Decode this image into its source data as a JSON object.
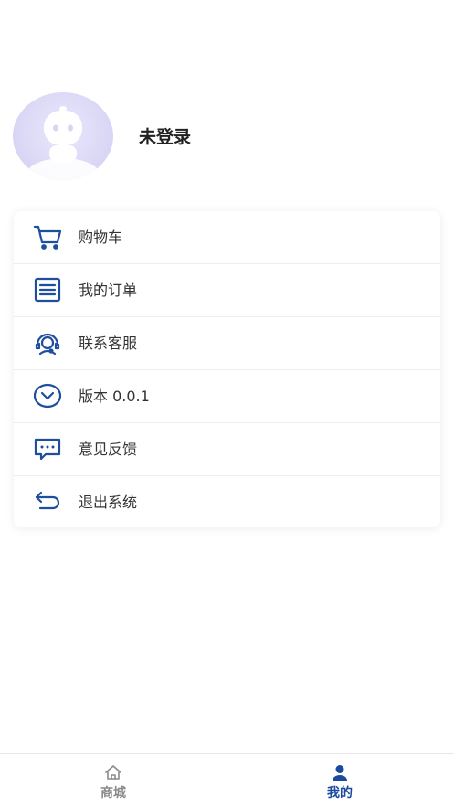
{
  "profile": {
    "username": "未登录"
  },
  "menu": {
    "items": [
      {
        "label": "购物车",
        "icon": "cart-icon"
      },
      {
        "label": "我的订单",
        "icon": "order-list-icon"
      },
      {
        "label": "联系客服",
        "icon": "customer-service-icon"
      },
      {
        "label": "版本 0.0.1",
        "icon": "chevron-down-circle-icon"
      },
      {
        "label": "意见反馈",
        "icon": "feedback-chat-icon"
      },
      {
        "label": "退出系统",
        "icon": "back-arrow-icon"
      }
    ]
  },
  "tabbar": {
    "tabs": [
      {
        "label": "商城",
        "icon": "home-icon",
        "active": false
      },
      {
        "label": "我的",
        "icon": "user-icon",
        "active": true
      }
    ]
  },
  "colors": {
    "accent": "#1c4a9c",
    "icon": "#1e4f9e",
    "inactive_tab": "#8a8a8a",
    "avatar_bg": "#dcdaf6"
  }
}
